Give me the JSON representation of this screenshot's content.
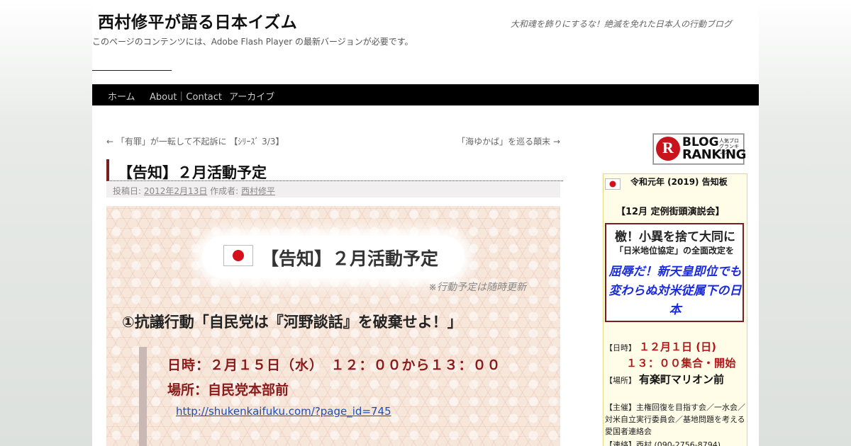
{
  "header": {
    "site_title": "西村修平が語る日本イズム",
    "site_description": "大和魂を飾りにするな！絶滅を免れた日本人の行動ブログ",
    "flash_notice": "このページのコンテンツには、Adobe Flash Player の最新バージョンが必要です。"
  },
  "nav": {
    "items": [
      "ホーム",
      "About｜Contact",
      "アーカイブ"
    ]
  },
  "post_nav": {
    "prev": "← 「有罪」が一転して不起訴に 【ｼﾘｰｽﾞ 3/3】",
    "next": "「海ゆかば」を巡る顛末 →"
  },
  "post": {
    "title": "【告知】２月活動予定",
    "meta_posted_label": "投稿日:",
    "meta_date": "2012年2月13日",
    "meta_author_label": "作成者:",
    "meta_author": "西村修平"
  },
  "content": {
    "banner_title": "【告知】２月活動予定",
    "update_note": "※行動予定は随時更新",
    "heading1": "①抗議行動「自民党は『河野談話』を破棄せよ！」",
    "time_line": "日時：２月１５日（水）　１２：００から１３：００",
    "place_line": "場所：自民党本部前",
    "link": "http://shukenkaifuku.com/?page_id=745"
  },
  "sidebar": {
    "ranking_badge": {
      "letter": "R",
      "small_text": "人気ブログランキング",
      "line1": "BLOG",
      "line2": "RANKING"
    },
    "widget": {
      "header": "令和元年 (2019) 告知板",
      "subheader": "【12月 定例街頭演説会】",
      "box_line1": "檄！小異を捨て大同に",
      "box_line2": "「日米地位協定」の全面改定を",
      "box_line3": "屈辱だ！新天皇即位でも変わらぬ対米従属下の日本",
      "date_label": "【日時】",
      "date_value": "１２月１日 (日)",
      "time_value": "１３：００集合・開始",
      "place_label": "【場所】",
      "place_value": "有楽町マリオン前",
      "organizer": "【主催】主権回復を目指す会／一水会／対米自立実行委員会／基地問題を考える愛国者連絡会",
      "contact": "【連絡】西村 (090-2756-8794)"
    }
  },
  "colors": {
    "nav_bg": "#000000",
    "title_accent": "#7a1f1f",
    "event_red": "#8b1a1a",
    "link_blue": "#1a4fb5",
    "widget_blue_text": "#1a2ae0"
  }
}
